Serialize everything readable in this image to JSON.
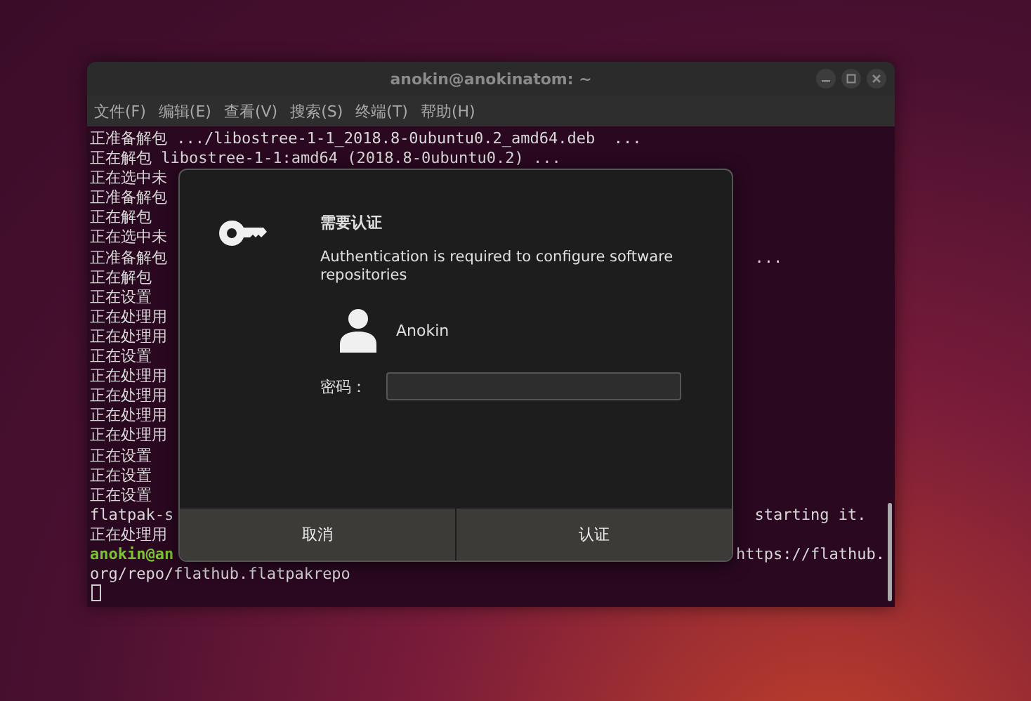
{
  "terminal": {
    "title": "anokin@anokinatom: ~",
    "menu": [
      "文件(F)",
      "编辑(E)",
      "查看(V)",
      "搜索(S)",
      "终端(T)",
      "帮助(H)"
    ],
    "lines": [
      {
        "kind": "output",
        "left": "正准备解包 .../libostree-1-1_2018.8-0ubuntu0.2_amd64.deb  ..."
      },
      {
        "kind": "output",
        "left": "正在解包 libostree-1-1:amd64 (2018.8-0ubuntu0.2) ..."
      },
      {
        "kind": "output",
        "left": "正在选中未"
      },
      {
        "kind": "output",
        "left": "正准备解包"
      },
      {
        "kind": "output",
        "left": "正在解包"
      },
      {
        "kind": "output",
        "left": "正在选中未"
      },
      {
        "kind": "output",
        "left": "正准备解包",
        "right": "  ..."
      },
      {
        "kind": "output",
        "left": "正在解包"
      },
      {
        "kind": "output",
        "left": "正在设置"
      },
      {
        "kind": "output",
        "left": "正在处理用"
      },
      {
        "kind": "output",
        "left": "正在处理用"
      },
      {
        "kind": "output",
        "left": "正在设置"
      },
      {
        "kind": "output",
        "left": "正在处理用"
      },
      {
        "kind": "output",
        "left": "正在处理用"
      },
      {
        "kind": "output",
        "left": "正在处理用"
      },
      {
        "kind": "output",
        "left": "正在处理用"
      },
      {
        "kind": "output",
        "left": "正在设置"
      },
      {
        "kind": "output",
        "left": "正在设置"
      },
      {
        "kind": "output",
        "left": "正在设置"
      },
      {
        "kind": "output",
        "left": "flatpak-s",
        "right": "  starting it."
      },
      {
        "kind": "output",
        "left": "正在处理用"
      },
      {
        "kind": "prompt",
        "left": "anokin@an",
        "right": "https://flathub."
      },
      {
        "kind": "output",
        "left": "org/repo/flathub.flatpakrepo"
      }
    ]
  },
  "dialog": {
    "title": "需要认证",
    "message": "Authentication is required to configure software repositories",
    "user": "Anokin",
    "password_label": "密码：",
    "buttons": [
      {
        "label": "取消"
      },
      {
        "label": "认证"
      }
    ]
  }
}
